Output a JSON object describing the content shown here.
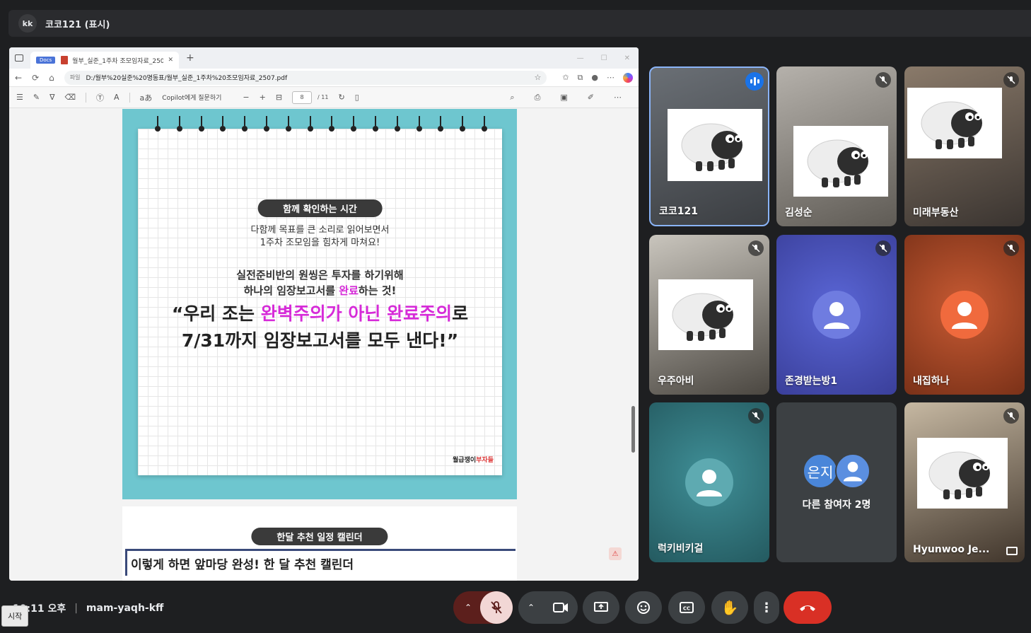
{
  "meeting": {
    "presenter_initials": "kk",
    "presenting_title": "코코121 (표시)",
    "time": "10:11 오후",
    "code": "mam-yaqh-kff",
    "start_label": "시작"
  },
  "browser": {
    "tab_badge": "Docs",
    "tab_title": "월부_실준_1주차 조모임자료_250",
    "address_label": "파일",
    "url": "D:/월부%20실준%20명동표/월부_실준_1주차%20조모임자료_2507.pdf",
    "copilot_prompt": "Copilot에게 질문하기",
    "page_number": "8",
    "page_total": "/ 11"
  },
  "pdf": {
    "page1": {
      "pill": "함께 확인하는 시간",
      "line1": "다함께 목표를 큰 소리로 읽어보면서",
      "line2": "1주차 조모임을 힘차게 마쳐요!",
      "line3": "실전준비반의 원씽은 투자를 하기위해",
      "line4_pre": "하나의 임장보고서를 ",
      "line4_hl": "완료",
      "line4_post": "하는 것!",
      "quote1_pre": "“우리 조는 ",
      "quote1_hl": "완벽주의가 아닌 완료주의",
      "quote1_post": "로",
      "quote2": "7/31까지 임장보고서를 모두 낸다!”",
      "brand_black": "월급쟁이",
      "brand_red": "부자들"
    },
    "page2": {
      "pill": "한달 추천 일정 캘린더",
      "headline": "이렇게 하면 앞마당 완성! 한 달 추천 캘린더"
    }
  },
  "participants": [
    {
      "name": "코코121",
      "type": "sheep",
      "speaking": true
    },
    {
      "name": "김성순",
      "type": "sheep",
      "muted": true
    },
    {
      "name": "미래부동산",
      "type": "sheep",
      "muted": true
    },
    {
      "name": "우주아비",
      "type": "sheep",
      "muted": true
    },
    {
      "name": "존경받는방1",
      "type": "avatar",
      "color": "#4a56c9",
      "muted": true
    },
    {
      "name": "내집하나",
      "type": "avatar",
      "color": "#e0542f",
      "muted": true
    },
    {
      "name": "럭키비키걸",
      "type": "avatar",
      "color": "#2f8a94",
      "muted": true
    },
    {
      "name": "다른 참여자 2명",
      "type": "others",
      "badge": "은지"
    },
    {
      "name": "Hyunwoo Je...",
      "type": "sheep",
      "muted": true
    }
  ],
  "colors": {
    "end_call": "#d93025",
    "mic_off_bg": "#f2d7d5",
    "accent_blue": "#8ab4f8"
  }
}
